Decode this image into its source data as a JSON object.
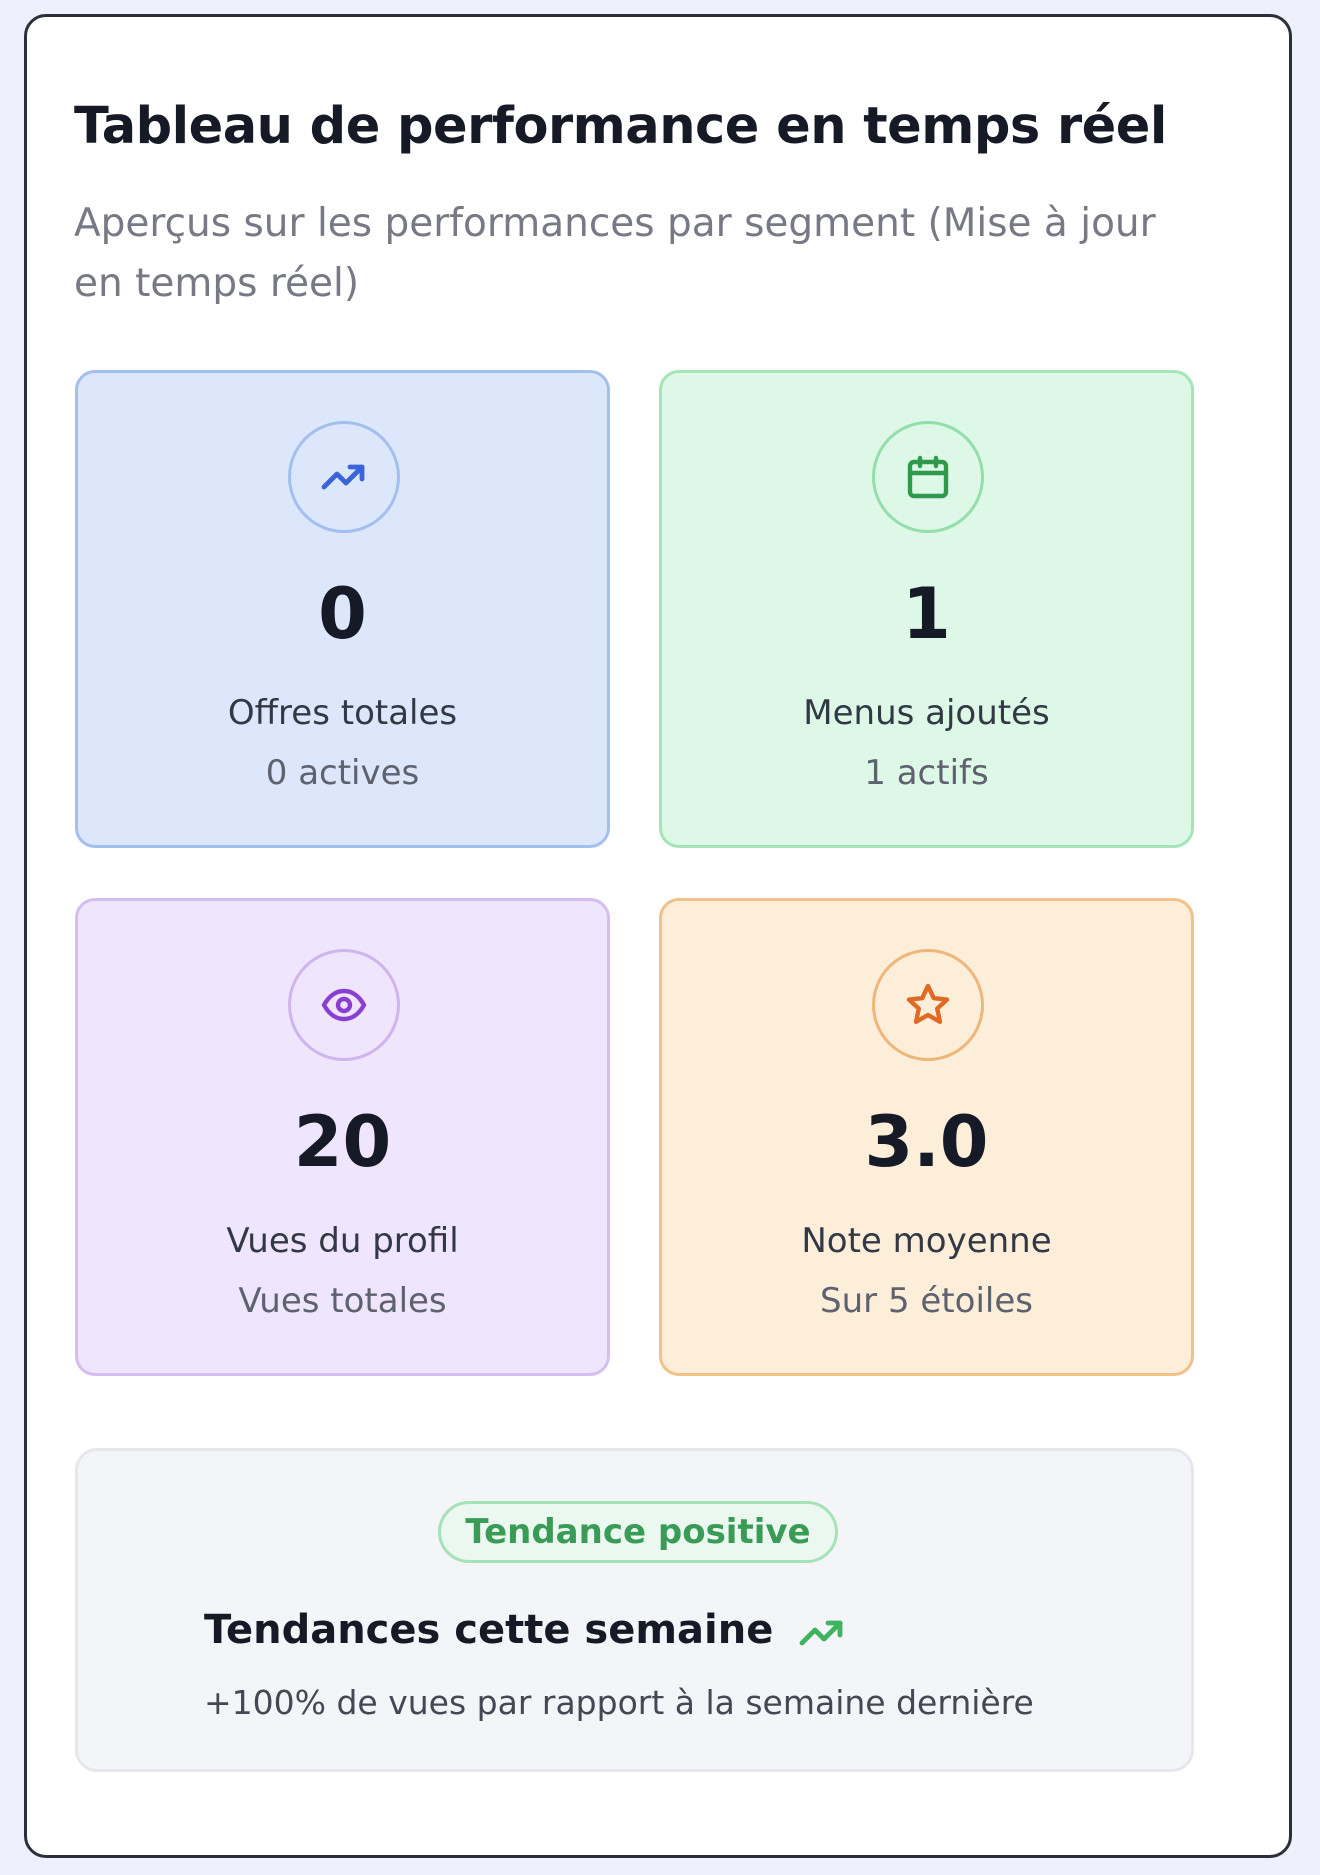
{
  "header": {
    "title": "Tableau de performance en temps réel",
    "subtitle": "Aperçus sur les performances par segment (Mise à jour en temps réel)"
  },
  "stats": [
    {
      "icon": "trending-up-icon",
      "value": "0",
      "label": "Offres totales",
      "sub": "0 actives",
      "accent": "#3b64d8"
    },
    {
      "icon": "calendar-icon",
      "value": "1",
      "label": "Menus ajoutés",
      "sub": "1 actifs",
      "accent": "#2f9a4c"
    },
    {
      "icon": "eye-icon",
      "value": "20",
      "label": "Vues du profil",
      "sub": "Vues totales",
      "accent": "#8a3fd3"
    },
    {
      "icon": "star-icon",
      "value": "3.0",
      "label": "Note moyenne",
      "sub": "Sur 5 étoiles",
      "accent": "#e06a24"
    }
  ],
  "trend": {
    "badge": "Tendance positive",
    "title": "Tendances cette semaine",
    "icon": "trending-up-icon",
    "text": "+100% de vues par rapport à la semaine dernière",
    "accent": "#3fb45e"
  }
}
